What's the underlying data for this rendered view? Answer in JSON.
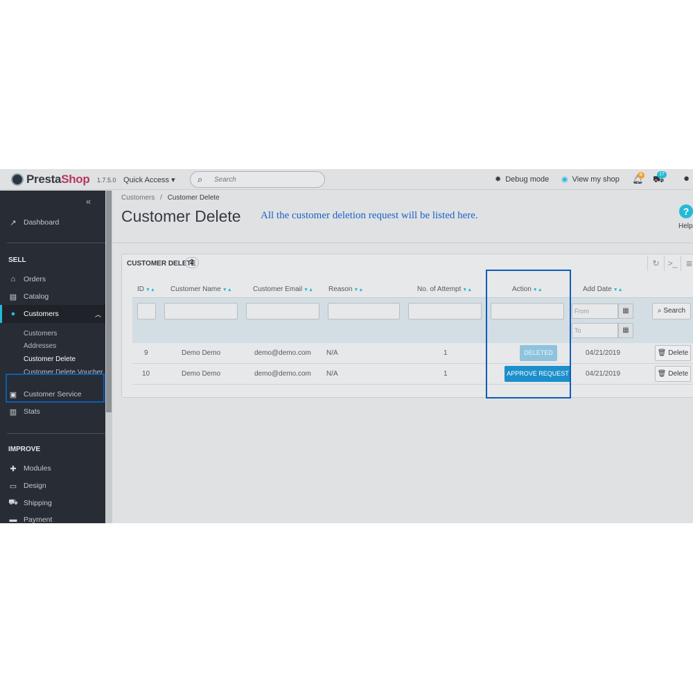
{
  "app": {
    "logo_name": "PrestaShop",
    "version": "1.7.5.0",
    "quick_access": "Quick Access",
    "search_placeholder": "Search",
    "debug_mode": "Debug mode",
    "view_shop": "View my shop",
    "notif_badge": "8",
    "cart_badge": "17"
  },
  "sidebar": {
    "dashboard": "Dashboard",
    "sell_heading": "SELL",
    "orders": "Orders",
    "catalog": "Catalog",
    "customers": "Customers",
    "sub_customers": "Customers",
    "sub_addresses": "Addresses",
    "sub_customer_delete": "Customer Delete",
    "sub_customer_delete_voucher": "Customer Delete Voucher",
    "customer_service": "Customer Service",
    "stats": "Stats",
    "improve_heading": "IMPROVE",
    "modules": "Modules",
    "design": "Design",
    "shipping": "Shipping",
    "payment": "Payment"
  },
  "header": {
    "breadcrumb_parent": "Customers",
    "breadcrumb_sep": "/",
    "breadcrumb_current": "Customer Delete",
    "title": "Customer Delete",
    "note": "All the customer deletion request will be listed here.",
    "help": "Help"
  },
  "panel": {
    "title": "CUSTOMER DELETE",
    "count": "2",
    "columns": {
      "id": "ID",
      "name": "Customer Name",
      "email": "Customer Email",
      "reason": "Reason",
      "attempt": "No. of Attempt",
      "action": "Action",
      "date": "Add Date"
    },
    "filters": {
      "from": "From",
      "to": "To",
      "search_button": "Search"
    },
    "rows": [
      {
        "id": "9",
        "name": "Demo Demo",
        "email": "demo@demo.com",
        "reason": "N/A",
        "attempt": "1",
        "action": "DELETED",
        "date": "04/21/2019",
        "delete": "Delete"
      },
      {
        "id": "10",
        "name": "Demo Demo",
        "email": "demo@demo.com",
        "reason": "N/A",
        "attempt": "1",
        "action": "APPROVE REQUEST",
        "date": "04/21/2019",
        "delete": "Delete"
      }
    ]
  },
  "colors": {
    "accent": "#25b9d7",
    "sidebar_bg": "#282c34",
    "highlight_box": "#0d5cb6",
    "approve_button": "#1c8fcc",
    "note_text": "#1a63c8"
  }
}
